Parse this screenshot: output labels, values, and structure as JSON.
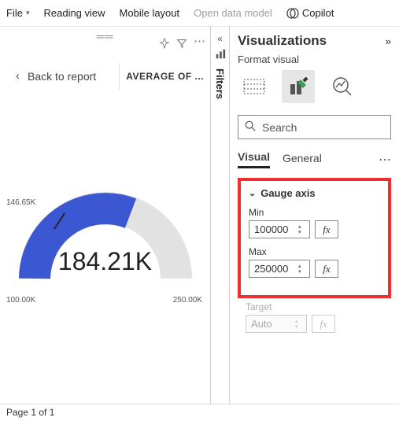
{
  "menubar": {
    "file": "File",
    "reading_view": "Reading view",
    "mobile_layout": "Mobile layout",
    "open_data_model": "Open data model",
    "copilot": "Copilot"
  },
  "canvas": {
    "back_label": "Back to report",
    "avg_label": "AVERAGE OF ..."
  },
  "chart_data": {
    "type": "gauge",
    "min": 100000,
    "max": 250000,
    "value": 184210,
    "tick": 146650,
    "min_label": "100.00K",
    "max_label": "250.00K",
    "tick_label": "146.65K",
    "value_label": "184.21K",
    "fill_color": "#3b57d1",
    "empty_color": "#e2e2e2"
  },
  "filters": {
    "label": "Filters"
  },
  "vis": {
    "title": "Visualizations",
    "subtitle": "Format visual",
    "search_placeholder": "Search",
    "tabs": {
      "visual": "Visual",
      "general": "General"
    },
    "section": "Gauge axis",
    "min_label": "Min",
    "min_value": "100000",
    "max_label": "Max",
    "max_value": "250000",
    "target_label": "Target",
    "target_value": "Auto",
    "fx": "fx"
  },
  "footer": {
    "page": "Page 1 of 1"
  }
}
